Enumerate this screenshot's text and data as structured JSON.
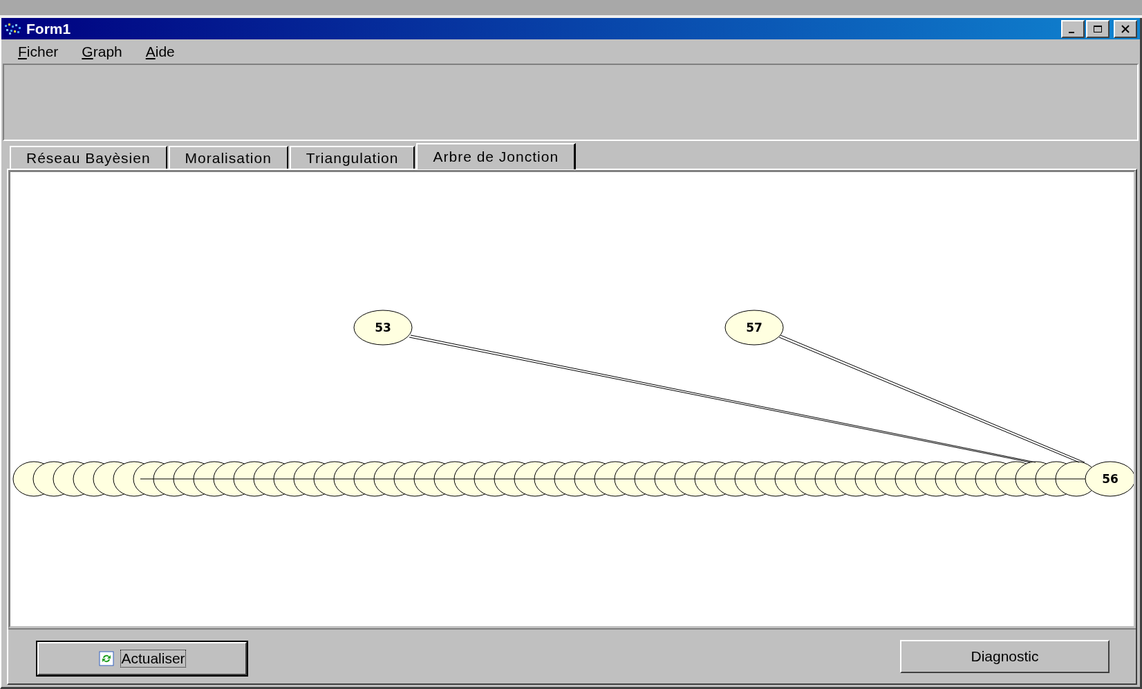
{
  "window": {
    "title": "Form1"
  },
  "menu": [
    {
      "label": "Ficher"
    },
    {
      "label": "Graph"
    },
    {
      "label": "Aide"
    }
  ],
  "tabs": [
    {
      "label": "Réseau Bayèsien",
      "selected": false
    },
    {
      "label": "Moralisation",
      "selected": false
    },
    {
      "label": "Triangulation",
      "selected": false
    },
    {
      "label": "Arbre de Jonction",
      "selected": true
    }
  ],
  "graph": {
    "nodes": [
      {
        "label": "53"
      },
      {
        "label": "57"
      },
      {
        "label": "56"
      }
    ]
  },
  "buttons": [
    {
      "label": "Actualiser",
      "focused": true
    },
    {
      "label": "Diagnostic",
      "focused": false
    }
  ]
}
